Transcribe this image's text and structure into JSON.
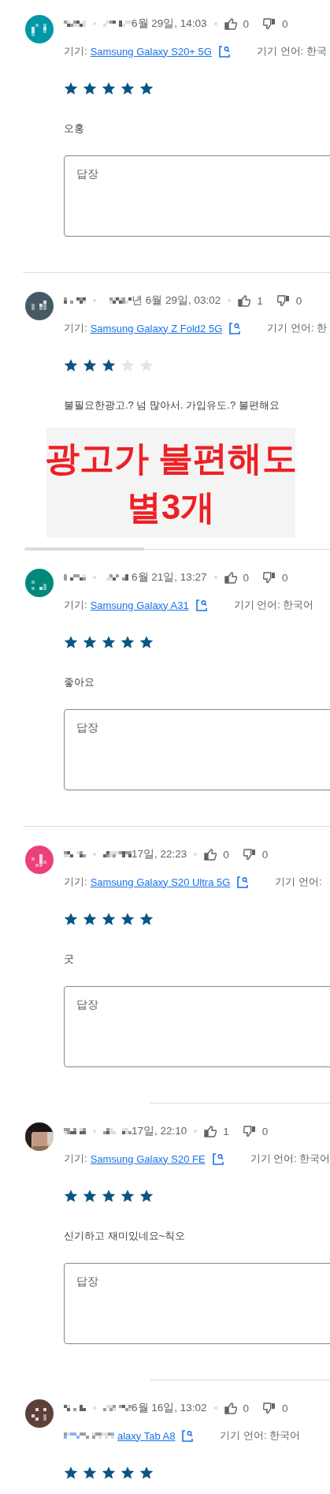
{
  "reviews": [
    {
      "avatar": {
        "kind": "initial",
        "color": "#0097a7"
      },
      "date": "6월 29일, 14:03",
      "likes": "0",
      "dislikes": "0",
      "device_label": "기기:",
      "device": "Samsung Galaxy S20+ 5G",
      "language": "기기 언어: 한국",
      "stars": 5,
      "text": "오홍",
      "reply_box": {
        "placeholder": "답장"
      },
      "divider": {
        "kind": "full"
      }
    },
    {
      "avatar": {
        "kind": "initial",
        "color": "#455a64"
      },
      "date": "년 6월 29일, 03:02",
      "likes": "1",
      "dislikes": "0",
      "device_label": "기기:",
      "device": "Samsung Galaxy Z Fold2 5G",
      "language": "기기 언어: 한",
      "stars": 3,
      "text": "불필요한광고.? 넘 많아서. 가입유도.? 불편해요",
      "annotation": {
        "lines": [
          "광고가 불편해도",
          "별3개"
        ]
      },
      "divider": {
        "kind": "scrollbar"
      }
    },
    {
      "avatar": {
        "kind": "initial",
        "color": "#00897b"
      },
      "date": "6월 21일, 13:27",
      "likes": "0",
      "dislikes": "0",
      "device_label": "기기:",
      "device": "Samsung Galaxy A31",
      "language": "기기 언어: 한국어",
      "stars": 5,
      "text": "좋아요",
      "reply_box": {
        "placeholder": "답장"
      },
      "divider": {
        "kind": "full"
      }
    },
    {
      "avatar": {
        "kind": "initial",
        "color": "#ec407a"
      },
      "date": "17일, 22:23",
      "likes": "0",
      "dislikes": "0",
      "device_label": "기기:",
      "device": "Samsung Galaxy S20 Ultra 5G",
      "language": "기기 언어:",
      "stars": 5,
      "text": "굿",
      "reply_box": {
        "placeholder": "답장"
      },
      "divider": {
        "kind": "partial"
      }
    },
    {
      "date": "17일, 22:10",
      "likes": "1",
      "dislikes": "0",
      "device_label": "기기:",
      "device": "Samsung Galaxy S20 FE",
      "language": "기기 언어: 한국어",
      "stars": 5,
      "text": "신기하고 재미있네요~칙오",
      "reply_box": {
        "placeholder": "답장"
      },
      "divider": {
        "kind": "partial"
      }
    },
    {
      "avatar": {
        "kind": "initial",
        "color": "#5d4037"
      },
      "date": "6월 16일, 13:02",
      "likes": "0",
      "dislikes": "0",
      "device": "alaxy Tab A8",
      "language": "기기 언어: 한국어",
      "stars": 5
    }
  ]
}
